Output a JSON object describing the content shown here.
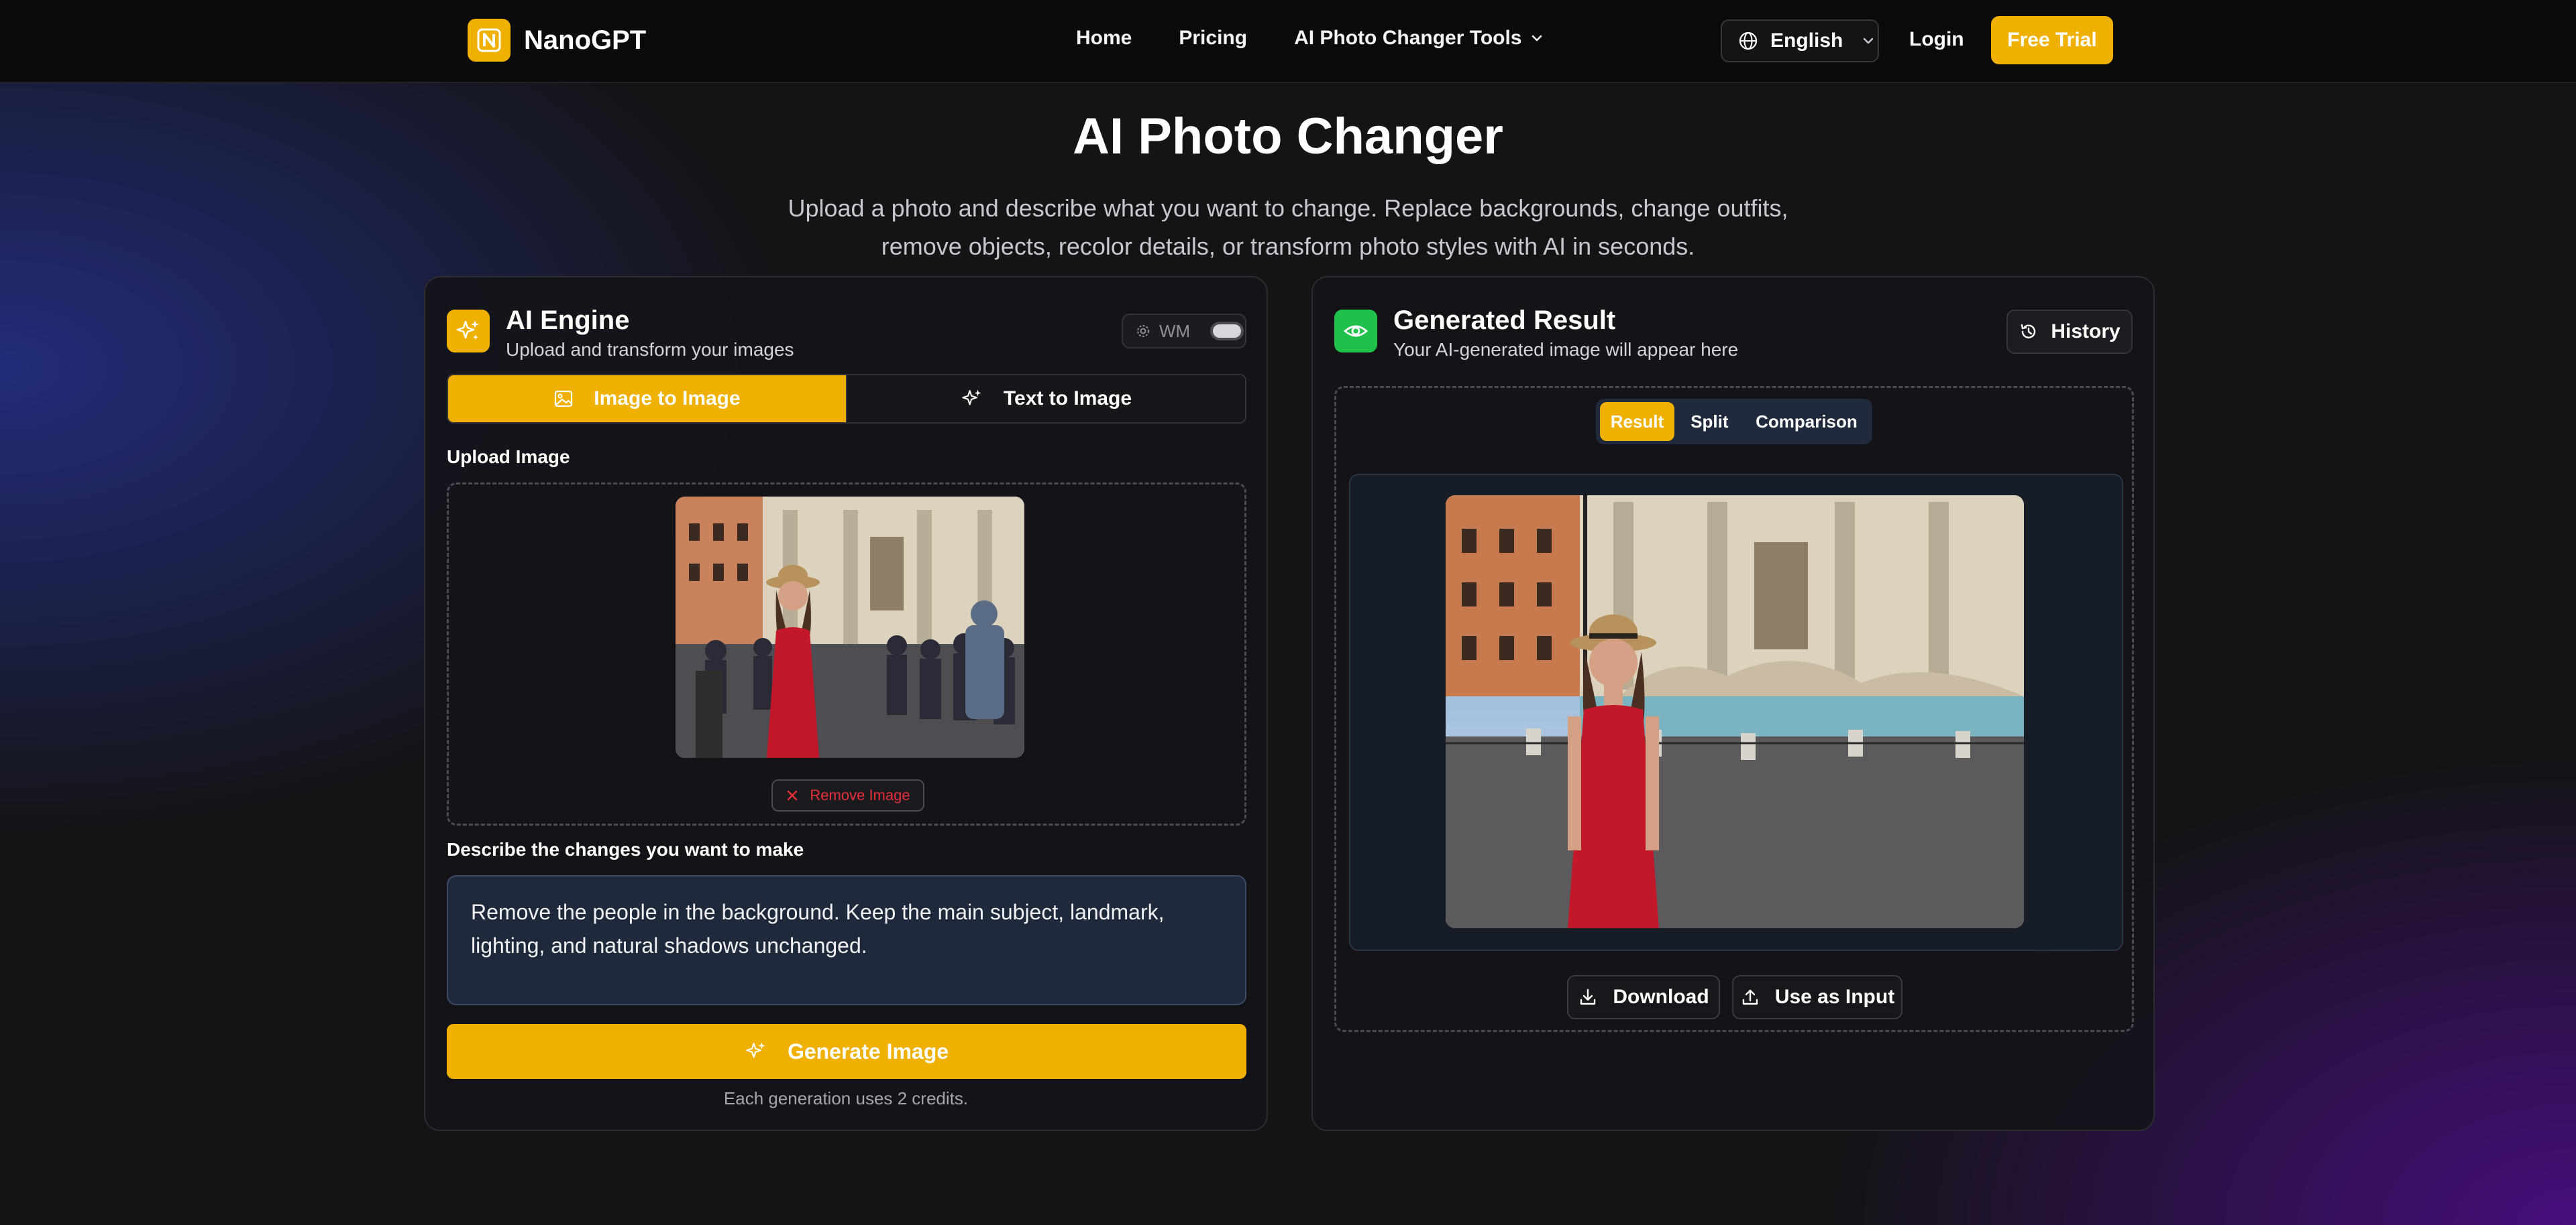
{
  "nav": {
    "brand": "NanoGPT",
    "links": [
      "Home",
      "Pricing",
      "AI Photo Changer Tools"
    ],
    "language": "English",
    "login": "Login",
    "cta": "Free Trial"
  },
  "hero": {
    "title": "AI Photo Changer",
    "subtitle_line1": "Upload a photo and describe what you want to change. Replace backgrounds, change outfits,",
    "subtitle_line2": "remove objects, recolor details, or transform photo styles with AI in seconds."
  },
  "engine": {
    "title": "AI Engine",
    "subtitle": "Upload and transform your images",
    "wm_label": "WM",
    "wm_enabled": false,
    "tabs": [
      "Image to Image",
      "Text to Image"
    ],
    "active_tab": "Image to Image",
    "upload_label": "Upload Image",
    "remove_label": "Remove Image",
    "prompt_label": "Describe the changes you want to make",
    "prompt_value": "Remove the people in the background. Keep the main subject, landmark, lighting, and natural shadows unchanged.",
    "generate_label": "Generate Image",
    "credits_note": "Each generation uses 2 credits."
  },
  "result": {
    "title": "Generated Result",
    "subtitle": "Your AI-generated image will appear here",
    "history_label": "History",
    "view_tabs": [
      "Result",
      "Split",
      "Comparison"
    ],
    "active_view": "Result",
    "download_label": "Download",
    "use_input_label": "Use as Input"
  },
  "colors": {
    "accent": "#f0b000",
    "success": "#1fc14a",
    "danger": "#e5303a",
    "background": "#141416"
  },
  "icons": [
    "brand-logo-icon",
    "chevron-down-icon",
    "globe-icon",
    "sparkles-icon",
    "settings-icon",
    "image-icon",
    "close-icon",
    "eye-icon",
    "history-icon",
    "download-icon",
    "upload-icon"
  ]
}
